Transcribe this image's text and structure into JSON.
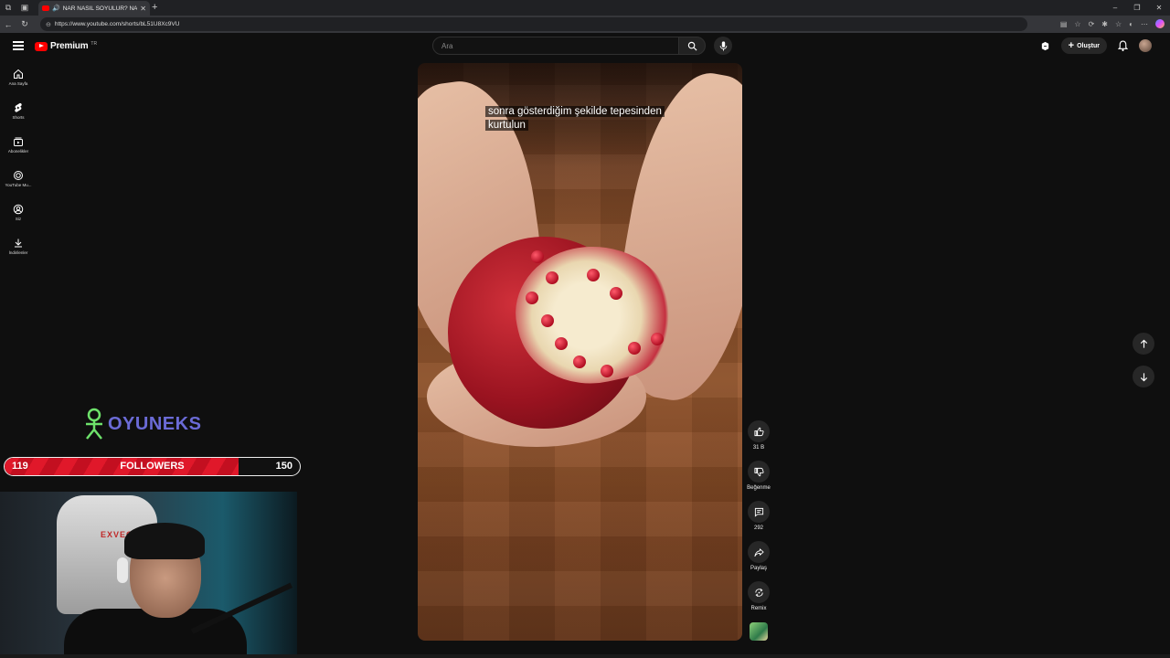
{
  "browser": {
    "tab_title": "NAR NASIL SOYULUR? NAR",
    "url": "https://www.youtube.com/shorts/bL51U8Xc9VU"
  },
  "masthead": {
    "logo_text": "Premium",
    "logo_sup": "TR",
    "search_placeholder": "Ara",
    "create_label": "Oluştur"
  },
  "guide": {
    "items": [
      {
        "label": "Ana Sayfa",
        "icon": "home-icon"
      },
      {
        "label": "Shorts",
        "icon": "shorts-icon"
      },
      {
        "label": "Abonelikler",
        "icon": "subscriptions-icon"
      },
      {
        "label": "YouTube Mu...",
        "icon": "youtube-music-icon"
      },
      {
        "label": "Siz",
        "icon": "you-icon"
      },
      {
        "label": "İndirilenler",
        "icon": "downloads-icon"
      }
    ]
  },
  "video": {
    "caption_line1": "sonra gösterdiğim şekilde tepesinden",
    "caption_line2": "kurtulun"
  },
  "actions": {
    "like_count": "31 B",
    "dislike_label": "Beğenme",
    "comment_count": "292",
    "share_label": "Paylaş",
    "remix_label": "Remix"
  },
  "overlay": {
    "brand_text": "OYUNEKS",
    "followers_current": "119",
    "followers_label": "FOLLOWERS",
    "followers_goal": "150",
    "followers_progress": 0.793,
    "chair_brand": "EXVEGA"
  },
  "colors": {
    "youtube_red": "#ff0000",
    "followers_bar": "#e0182a",
    "brand_purple": "#6b6bd6"
  }
}
